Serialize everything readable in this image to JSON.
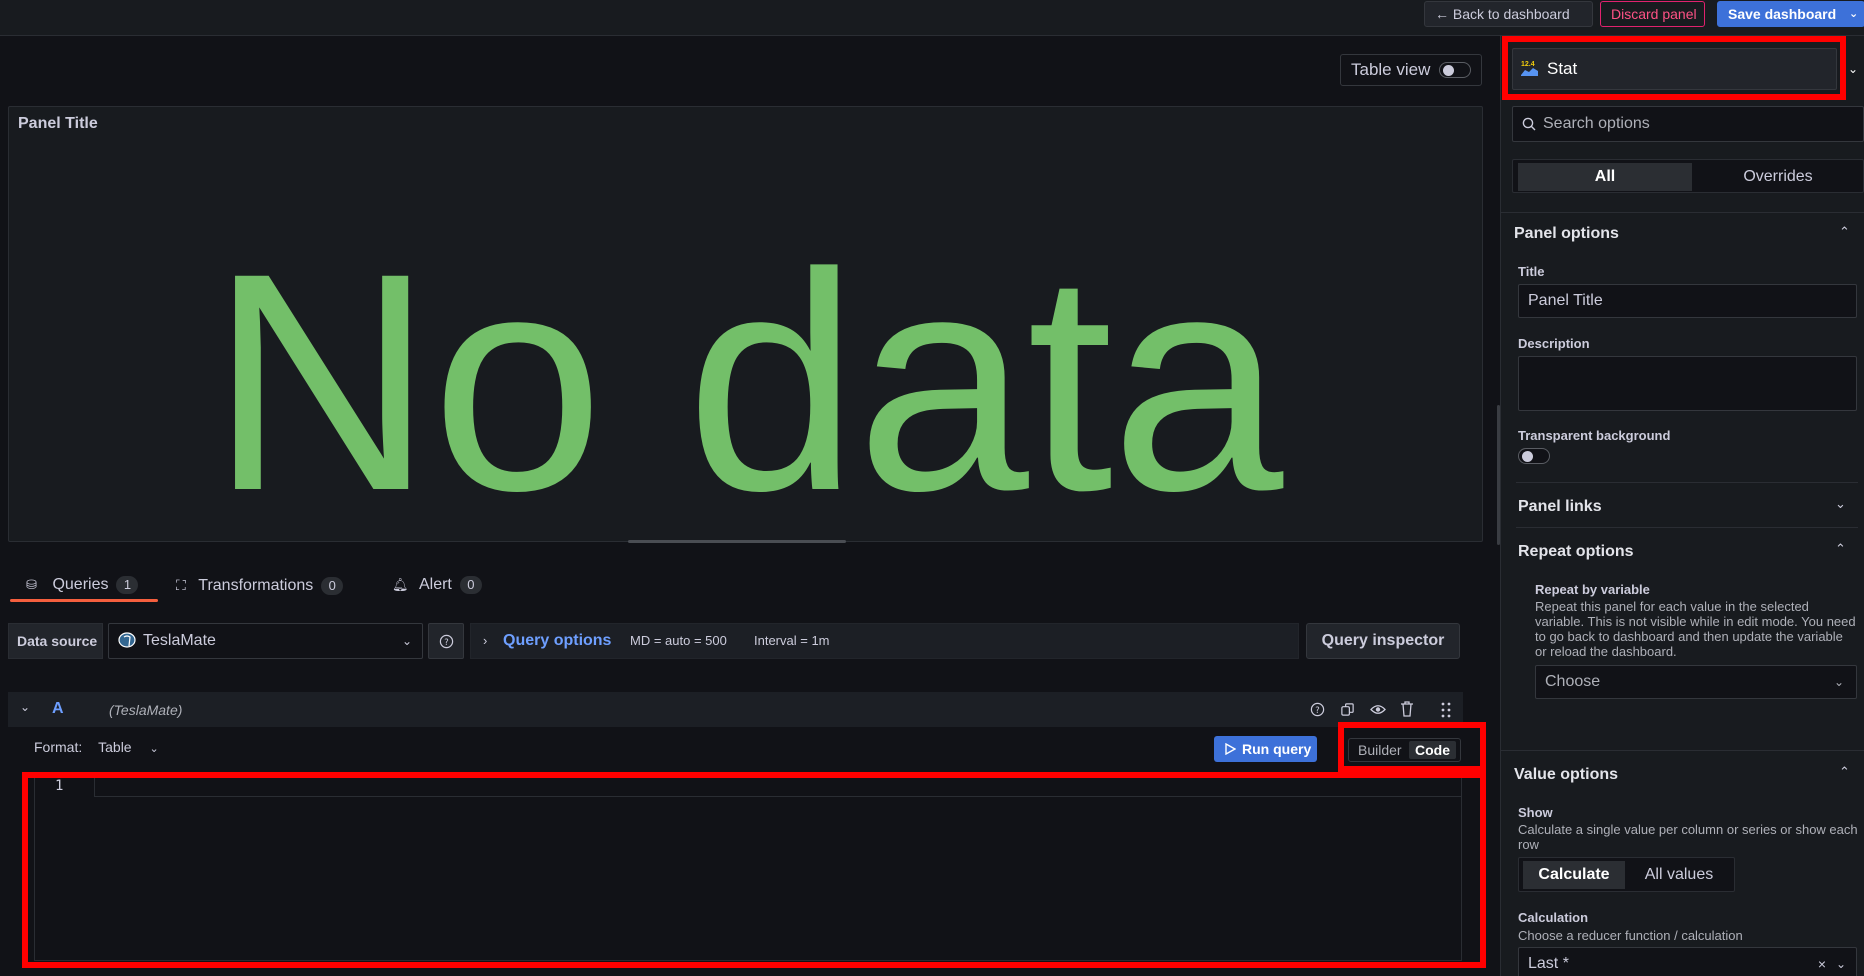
{
  "topbar": {
    "back_label": "Back to dashboard",
    "discard_label": "Discard panel",
    "save_label": "Save dashboard"
  },
  "left": {
    "table_view_label": "Table view",
    "panel_title": "Panel Title",
    "no_data_text": "No data"
  },
  "tabs": [
    {
      "label": "Queries",
      "count": "1"
    },
    {
      "label": "Transformations",
      "count": "0"
    },
    {
      "label": "Alert",
      "count": "0"
    }
  ],
  "datasource": {
    "label": "Data source",
    "value": "TeslaMate",
    "query_options_label": "Query options",
    "md_text": "MD = auto = 500",
    "interval_text": "Interval = 1m",
    "inspector_label": "Query inspector"
  },
  "query": {
    "ref_id": "A",
    "ds_name": "(TeslaMate)",
    "format_label": "Format:",
    "format_value": "Table",
    "run_label": "Run query",
    "builder_label": "Builder",
    "code_label": "Code",
    "line_number": "1"
  },
  "options": {
    "viz_name": "Stat",
    "viz_icon_text": "12.4",
    "search_placeholder": "Search options",
    "tab_all": "All",
    "tab_overrides": "Overrides",
    "panel_options_header": "Panel options",
    "title_label": "Title",
    "title_value": "Panel Title",
    "description_label": "Description",
    "transparent_label": "Transparent background",
    "panel_links_header": "Panel links",
    "repeat_header": "Repeat options",
    "repeat_by_label": "Repeat by variable",
    "repeat_desc": "Repeat this panel for each value in the selected variable. This is not visible while in edit mode. You need to go back to dashboard and then update the variable or reload the dashboard.",
    "choose_placeholder": "Choose",
    "value_options_header": "Value options",
    "show_label": "Show",
    "show_desc": "Calculate a single value per column or series or show each row",
    "show_calculate": "Calculate",
    "show_all_values": "All values",
    "calc_label": "Calculation",
    "calc_desc": "Choose a reducer function / calculation",
    "calc_value": "Last *"
  },
  "colors": {
    "accent": "#3d71d9",
    "no_data": "#73bf69",
    "discard": "#ff5286",
    "tab_underline": "#f55f3e",
    "annotation": "#ff0000"
  }
}
